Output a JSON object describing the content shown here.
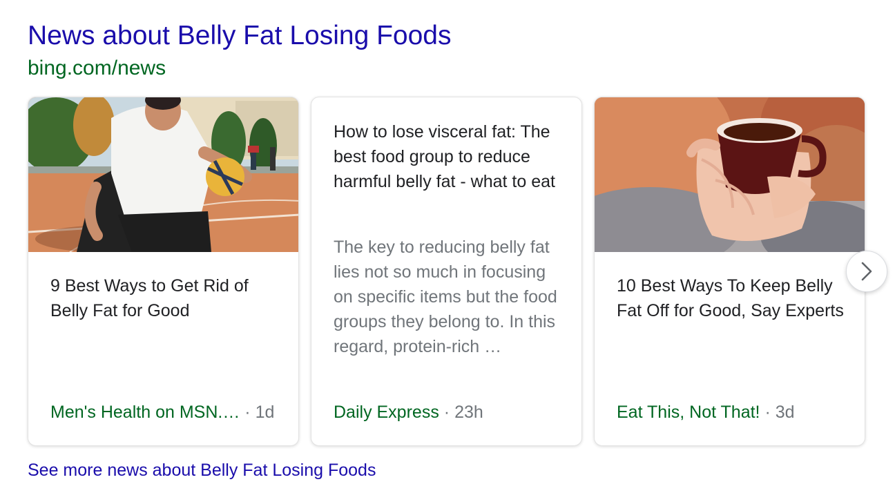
{
  "header": {
    "title": "News about Belly Fat Losing Foods",
    "source": "bing.com/news"
  },
  "cards": [
    {
      "headline": "9 Best Ways to Get Rid of Belly Fat for Good",
      "publisher": "Men's Health on MSN.…",
      "separator": "·",
      "age": "1d",
      "image": "basketball-player-photo"
    },
    {
      "headline": "How to lose visceral fat: The best food group to reduce harmful belly fat - what to eat",
      "snippet": "The key to reducing belly fat lies not so much in focusing on specific items but the food groups they belong to. In this regard, protein-rich …",
      "publisher": "Daily Express",
      "separator": "·",
      "age": "23h"
    },
    {
      "headline": "10 Best Ways To Keep Belly Fat Off for Good, Say Experts",
      "publisher": "Eat This, Not That!",
      "separator": "·",
      "age": "3d",
      "image": "tea-cup-photo"
    }
  ],
  "carousel": {
    "next_icon": "chevron-right-icon"
  },
  "footer": {
    "see_more": "See more news about Belly Fat Losing Foods"
  },
  "colors": {
    "link": "#1a0dab",
    "source_green": "#006621",
    "snippet_gray": "#70757a"
  }
}
